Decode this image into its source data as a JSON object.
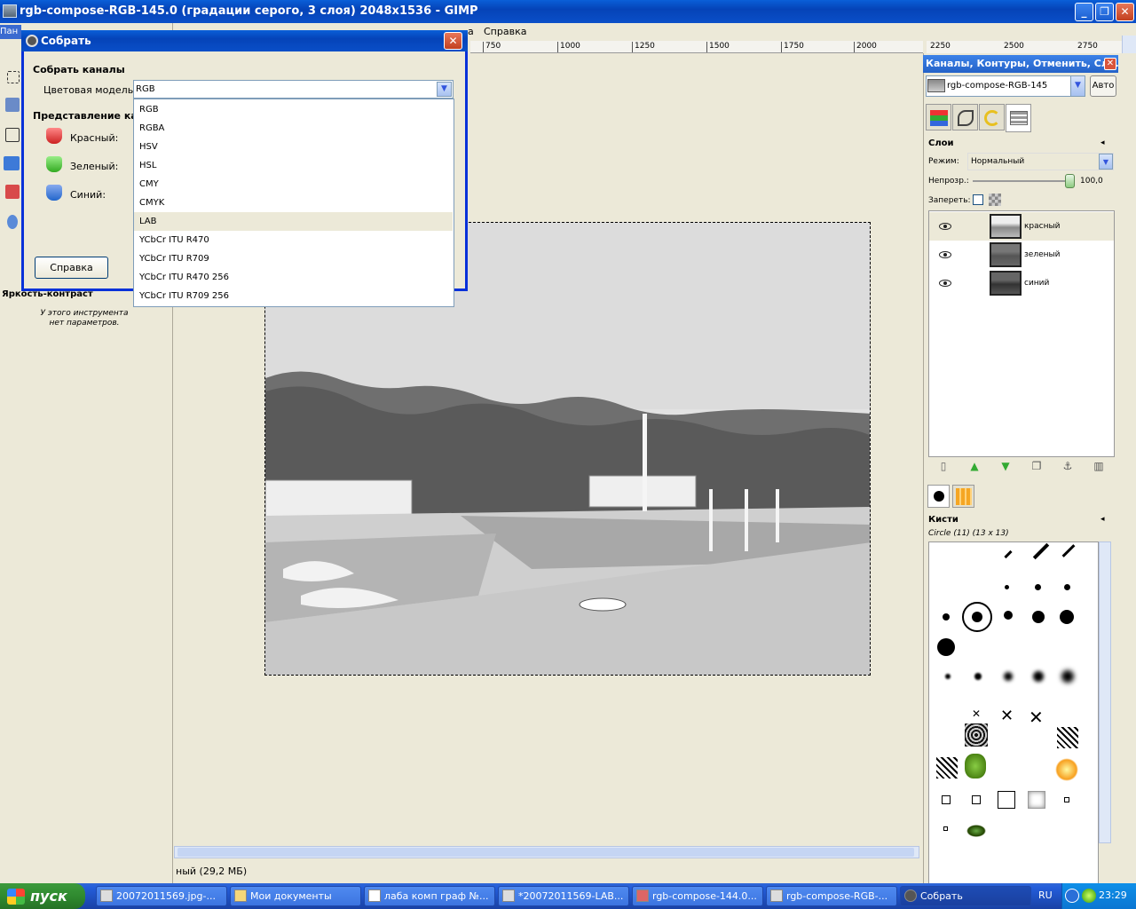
{
  "window": {
    "title": "rgb-compose-RGB-145.0 (градации серого, 3 слоя) 2048x1536 - GIMP",
    "min": "_",
    "max": "❐",
    "close": "✕"
  },
  "menubar": {
    "partial_left": "Пан",
    "partial_mid": "а",
    "help": "Справка"
  },
  "ruler": {
    "ticks": [
      "750",
      "1000",
      "1250",
      "1500",
      "1750",
      "2000",
      "2250",
      "2500",
      "2750"
    ]
  },
  "toolbox": {
    "options_title": "Яркость-контраст",
    "options_text": "У этого инструмента нет параметров."
  },
  "status": {
    "text": "ный (29,2 МБ)"
  },
  "dialog": {
    "title": "Собрать",
    "close": "✕",
    "section_compose": "Собрать каналы",
    "model_label": "Цветовая модель:",
    "model_value": "RGB",
    "section_channels": "Представление каналов",
    "channels": [
      {
        "label": "Красный:",
        "color": "#d83a3a"
      },
      {
        "label": "Зеленый:",
        "color": "#4caa3a"
      },
      {
        "label": "Синий:",
        "color": "#3a6ad0"
      }
    ],
    "help_button": "Справка",
    "dropdown_options": [
      "RGB",
      "RGBA",
      "HSV",
      "HSL",
      "CMY",
      "CMYK",
      "LAB",
      "YCbCr ITU R470",
      "YCbCr ITU R709",
      "YCbCr ITU R470 256",
      "YCbCr ITU R709 256"
    ],
    "highlighted_option": "LAB"
  },
  "right_panel": {
    "title": "Каналы, Контуры, Отменить, Сло...",
    "close": "✕",
    "image_name": "rgb-compose-RGB-145",
    "auto_button": "Авто",
    "layers": {
      "title": "Слои",
      "mode_label": "Режим:",
      "mode_value": "Нормальный",
      "opacity_label": "Непрозр.:",
      "opacity_value": "100,0",
      "opacity_level": 1.0,
      "lock_label": "Запереть:",
      "items": [
        {
          "name": "красный",
          "selected": true
        },
        {
          "name": "зеленый",
          "selected": false
        },
        {
          "name": "синий",
          "selected": false
        }
      ]
    },
    "brushes": {
      "title": "Кисти",
      "current": "Circle (11) (13 x 13)"
    }
  },
  "taskbar": {
    "start": "пуск",
    "tasks": [
      {
        "label": "20072011569.jpg-...",
        "active": false
      },
      {
        "label": "Мои документы",
        "active": false
      },
      {
        "label": "лаба комп граф №...",
        "active": false
      },
      {
        "label": "*20072011569-LAB...",
        "active": false
      },
      {
        "label": "rgb-compose-144.0...",
        "active": false
      },
      {
        "label": "rgb-compose-RGB-...",
        "active": false
      },
      {
        "label": "Собрать",
        "active": true
      }
    ],
    "language": "RU",
    "clock": "23:29"
  }
}
